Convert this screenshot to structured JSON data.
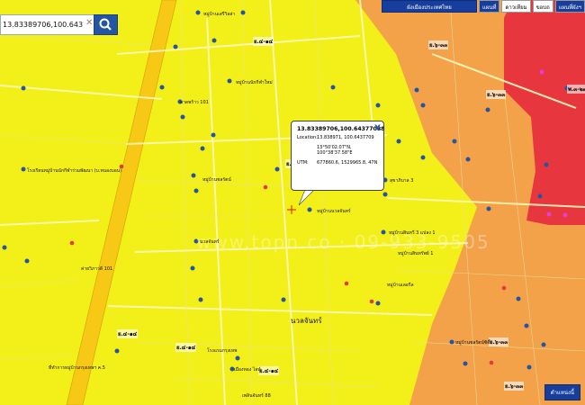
{
  "search": {
    "value": "13.83389706,100.64377088"
  },
  "top_controls": {
    "province_select": "ผังเมืองประเทศไทย",
    "map_btn": "แผนที่",
    "satellite_btn": "ดาวเทียม",
    "hybrid_btn": "ขอบถ",
    "landuse_btn": "แผนที่ผังฯ"
  },
  "popup": {
    "title": "13.83389706,100.64377088",
    "location_label": "Location:",
    "location_value": "13.838971, 100.6437709",
    "dms_lat": "13°50'02.07\"N,",
    "dms_lon": "100°38'37.58\"E",
    "utm_label": "UTM:",
    "utm_value": "677860.6, 1529965.8, 47N"
  },
  "zone_labels": [
    "ย.๔-๑๔",
    "ย.๔-๑๔",
    "ย.๔-๑๔",
    "ย.๔-๑๔",
    "ย.๔-๑๔",
    "ย.๖-๓๓",
    "ย.๖-๓๓",
    "พ.๓-๒๗",
    "ย.๖-๓๓",
    "ย.๖-๓๓"
  ],
  "place_labels": [
    "หมู่บ้านเสรีวิลล่า",
    "ลาดพร้าว 101",
    "โรงเรียนหมู่บ้านนักกีฬาร่วมพัฒนา (บ.หนองบอน)",
    "หมู่บ้านนักกีฬาใหม่",
    "ที่ทำการหมู่บ้านกรุงเทพฯ ค.5",
    "หมู่บ้านชลรัตน์",
    "สุขาภิบาล 3",
    "หมู่บ้านนวลจันทร์",
    "หมู่บ้านสินทวี 3 แปลง 1",
    "หมู่บ้านเลอรีล",
    "นวลจันทร์",
    "โรงแรมกรุงเทพ",
    "หมู่บ้านชลรัตน์ซิตี้",
    "หมู่บ้านสินทรัพย์ 1",
    "เมืองทอง ไลท์",
    "เพลินจันทร์ 88",
    "ค่ายวิภาวดี 101"
  ],
  "road_label": "นวลจันทร์",
  "bottom_button": "ตำแหน่งนี้",
  "colors": {
    "residential_low": "#f3ef18",
    "residential_med": "#f3a24a",
    "commercial": "#e8363e",
    "water_blue": "#2455a4"
  }
}
